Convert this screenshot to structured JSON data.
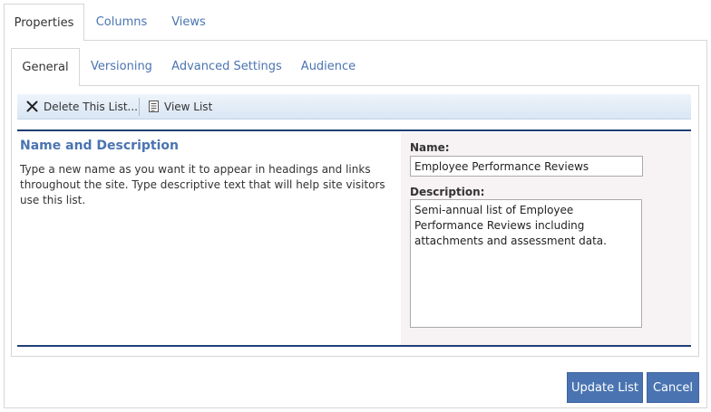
{
  "outer_tabs": [
    {
      "label": "Properties"
    },
    {
      "label": "Columns"
    },
    {
      "label": "Views"
    }
  ],
  "inner_tabs": [
    {
      "label": "General"
    },
    {
      "label": "Versioning"
    },
    {
      "label": "Advanced Settings"
    },
    {
      "label": "Audience"
    }
  ],
  "toolbar": {
    "delete_label": "Delete This List...",
    "view_label": "View List"
  },
  "section": {
    "title": "Name and Description",
    "description": "Type a new name as you want it to appear in headings and links throughout the site. Type descriptive text that will help site visitors use this list."
  },
  "form": {
    "name_label": "Name:",
    "name_value": "Employee Performance Reviews",
    "description_label": "Description:",
    "description_value": "Semi-annual list of Employee Performance Reviews including attachments and assessment data."
  },
  "actions": {
    "update_label": "Update List",
    "cancel_label": "Cancel"
  },
  "colors": {
    "accent": "#4a74b1",
    "rule": "#1f3f78"
  }
}
